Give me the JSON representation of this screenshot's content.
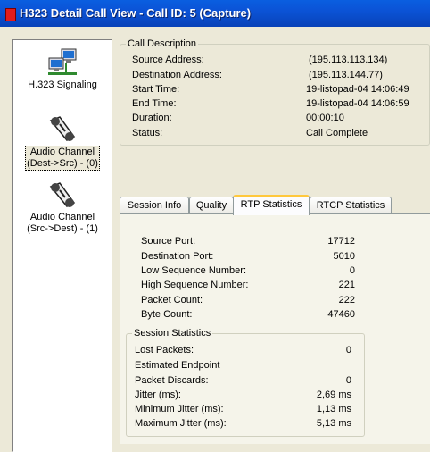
{
  "window": {
    "title": "H323 Detail Call View - Call ID: 5 (Capture)"
  },
  "nav": [
    {
      "label": "H.323 Signaling",
      "icon": "network-computers-icon"
    },
    {
      "label_line1": "Audio Channel",
      "label_line2": "(Dest->Src) - (0)",
      "icon": "audio-channel-icon"
    },
    {
      "label_line1": "Audio Channel",
      "label_line2": "(Src->Dest) - (1)",
      "icon": "audio-channel-icon"
    }
  ],
  "call_description": {
    "legend": "Call Description",
    "rows": [
      {
        "label": "Source Address:",
        "value": "(195.113.113.134)"
      },
      {
        "label": "Destination Address:",
        "value": "(195.113.144.77)"
      },
      {
        "label": "Start Time:",
        "value": "19-listopad-04  14:06:49"
      },
      {
        "label": "End Time:",
        "value": "19-listopad-04  14:06:59"
      },
      {
        "label": "Duration:",
        "value": "00:00:10"
      },
      {
        "label": "Status:",
        "value": "Call Complete"
      }
    ]
  },
  "tabs": [
    "Session Info",
    "Quality",
    "RTP Statistics",
    "RTCP Statistics"
  ],
  "active_tab": "RTP Statistics",
  "rtp_stats": [
    {
      "label": "Source Port:",
      "value": "17712"
    },
    {
      "label": "Destination Port:",
      "value": "5010"
    },
    {
      "label": "Low Sequence Number:",
      "value": "0"
    },
    {
      "label": "High Sequence Number:",
      "value": "221"
    },
    {
      "label": "Packet Count:",
      "value": "222"
    },
    {
      "label": "Byte Count:",
      "value": "47460"
    }
  ],
  "session_statistics": {
    "legend": "Session Statistics",
    "rows": [
      {
        "label": "Lost Packets:",
        "value": "0"
      },
      {
        "label": "Estimated Endpoint",
        "value": ""
      },
      {
        "label": "Packet Discards:",
        "value": "0"
      },
      {
        "label": "Jitter (ms):",
        "value": "2,69 ms"
      },
      {
        "label": "Minimum Jitter (ms):",
        "value": "1,13 ms"
      },
      {
        "label": "Maximum Jitter (ms):",
        "value": "5,13 ms"
      }
    ]
  },
  "colors": {
    "titlebar": "#0a5fe0",
    "active_tab_accent": "#ffc83c",
    "face": "#ece9d8"
  }
}
